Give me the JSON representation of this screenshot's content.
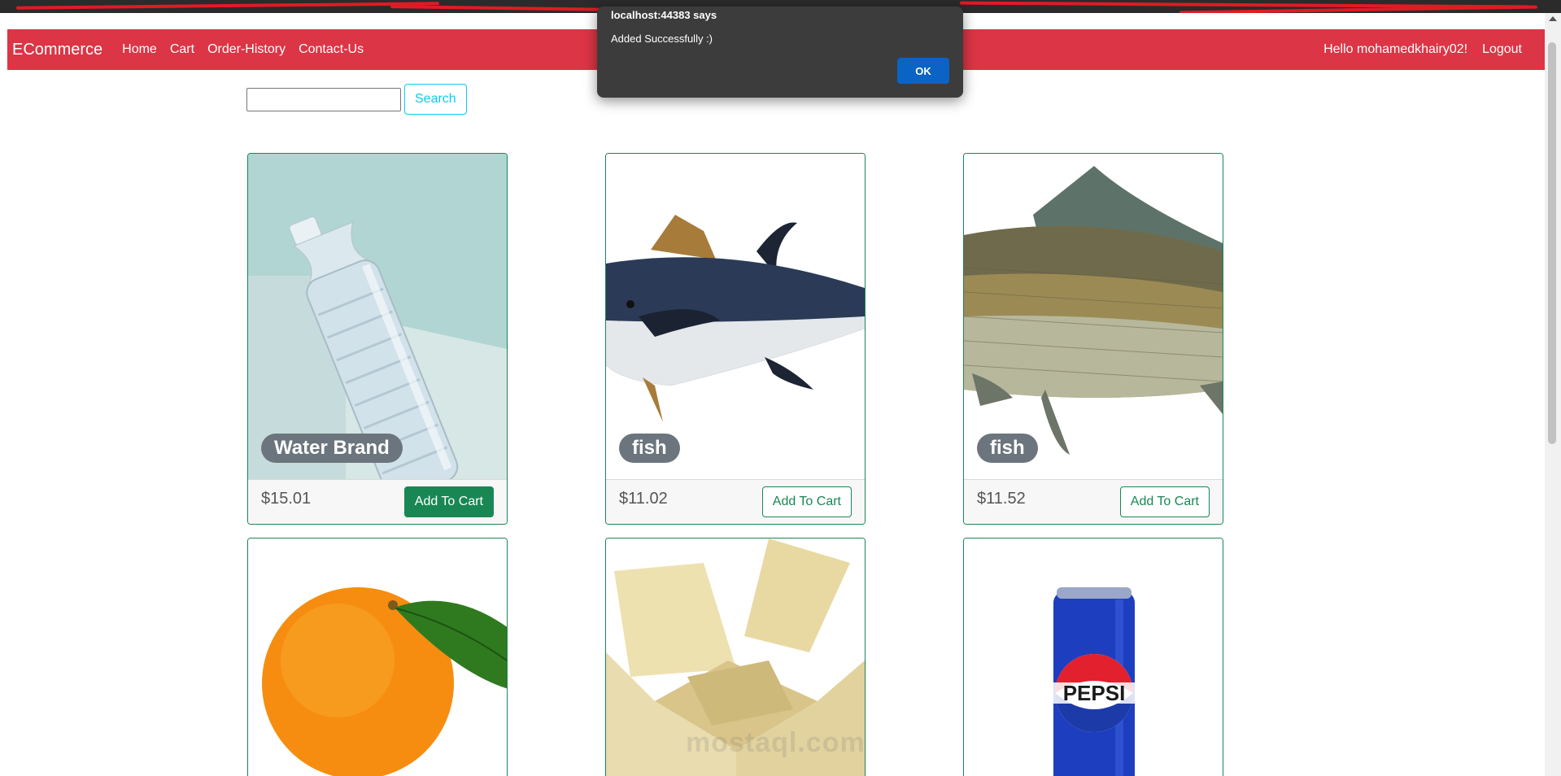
{
  "navbar": {
    "brand": "ECommerce",
    "links": [
      "Home",
      "Cart",
      "Order-History",
      "Contact-Us"
    ],
    "greeting": "Hello mohamedkhairy02!",
    "logout": "Logout",
    "color": "#dc3545"
  },
  "search": {
    "value": "",
    "button_label": "Search"
  },
  "products": [
    {
      "name": "Water Brand",
      "price": "$15.01",
      "button_label": "Add To Cart",
      "image": "water-bottle-image"
    },
    {
      "name": "fish",
      "price": "$11.02",
      "button_label": "Add To Cart",
      "image": "tuna-fish-image"
    },
    {
      "name": "fish",
      "price": "$11.52",
      "button_label": "Add To Cart",
      "image": "carp-fish-image"
    },
    {
      "image": "orange-image"
    },
    {
      "image": "cardboard-box-image"
    },
    {
      "image": "pepsi-can-image"
    }
  ],
  "dialog": {
    "title": "localhost:44383 says",
    "message": "Added Successfully :)",
    "ok_label": "OK"
  },
  "watermark": "mostaql.com",
  "colors": {
    "success": "#198754",
    "info": "#0dcaf0",
    "dialog_bg": "#3c3c3c",
    "ok_button": "#0b63c5"
  }
}
